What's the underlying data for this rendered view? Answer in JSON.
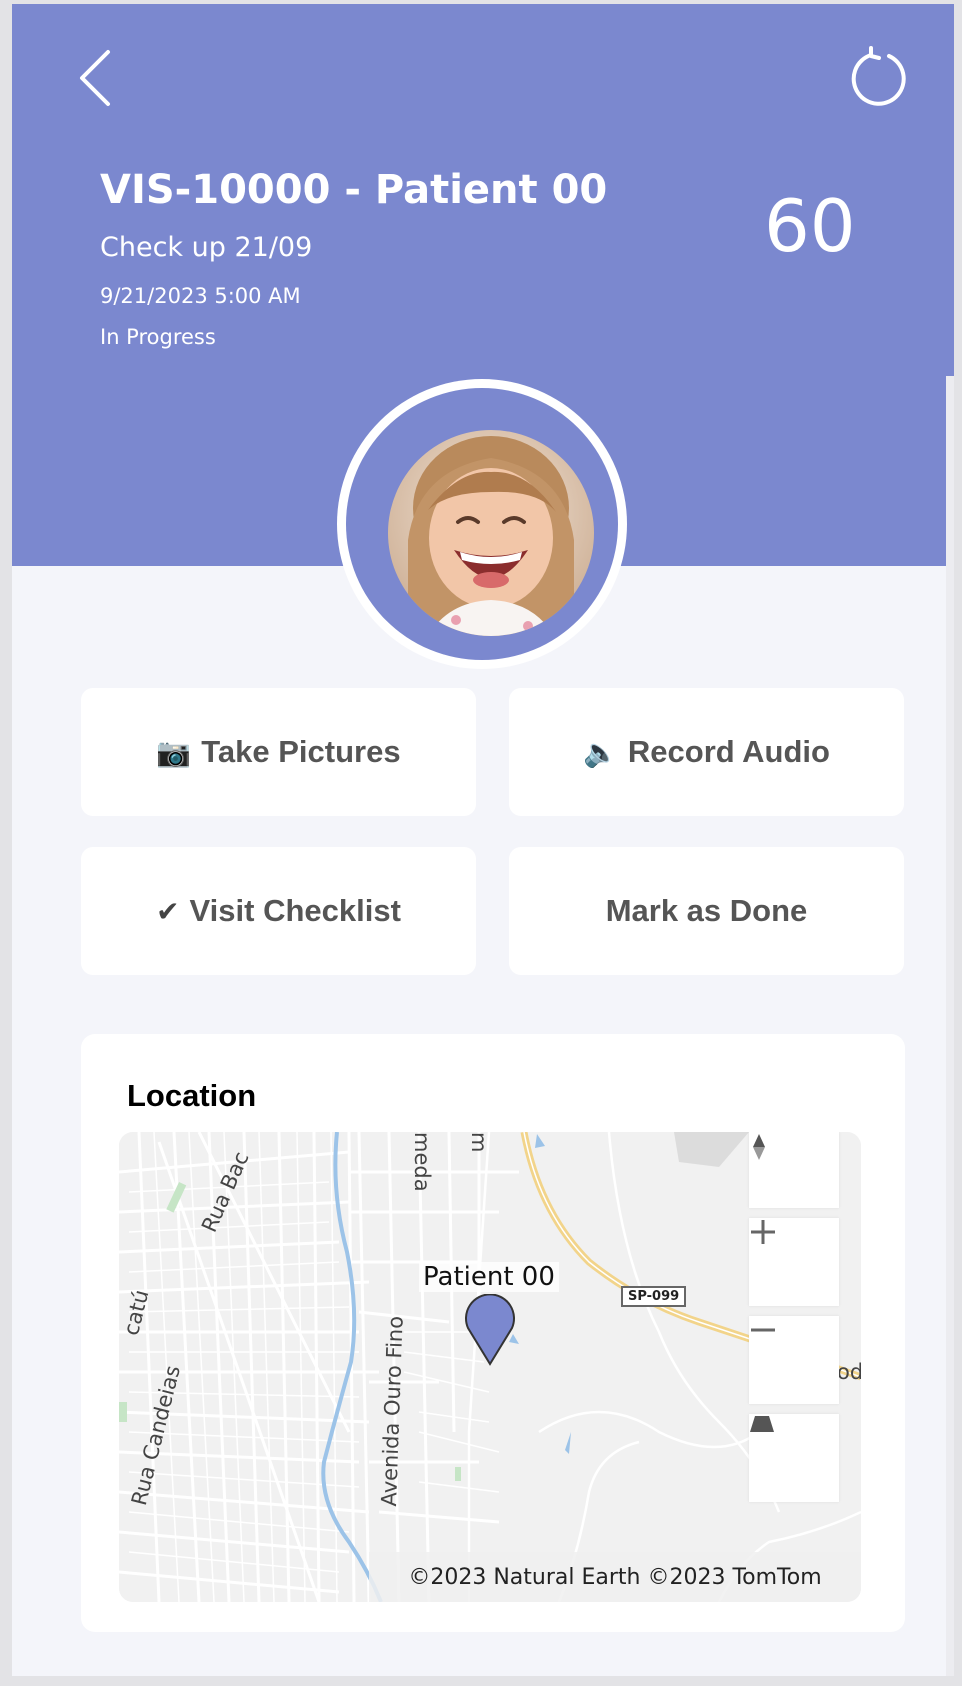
{
  "header": {
    "title": "VIS-10000 - Patient 00",
    "subtitle": "Check up 21/09",
    "datetime": "9/21/2023 5:00 AM",
    "status": "In Progress",
    "score": "60",
    "back_icon": "chevron-left-icon",
    "refresh_icon": "refresh-icon"
  },
  "actions": {
    "take_pictures": {
      "icon": "📷",
      "label": "Take Pictures"
    },
    "record_audio": {
      "icon": "🔈",
      "label": "Record Audio"
    },
    "visit_checklist": {
      "icon": "✔",
      "label": "Visit Checklist"
    },
    "mark_as_done": {
      "label": "Mark as Done"
    }
  },
  "location": {
    "title": "Location",
    "map": {
      "pin_label": "Patient 00",
      "attribution": "©2023 Natural Earth ©2023 TomTom",
      "road_badge": "SP-099",
      "streets": [
        "Rua Bac",
        "Rua Candeias",
        "Avenida Ouro Fino",
        "meda",
        "m",
        "catú",
        "od"
      ],
      "controls": [
        "compass-icon",
        "zoom-in-icon",
        "zoom-out-icon",
        "pitch-icon"
      ]
    }
  },
  "colors": {
    "accent": "#7b88cf",
    "background": "#f4f5fa",
    "card": "#ffffff",
    "button_text": "#555555"
  }
}
